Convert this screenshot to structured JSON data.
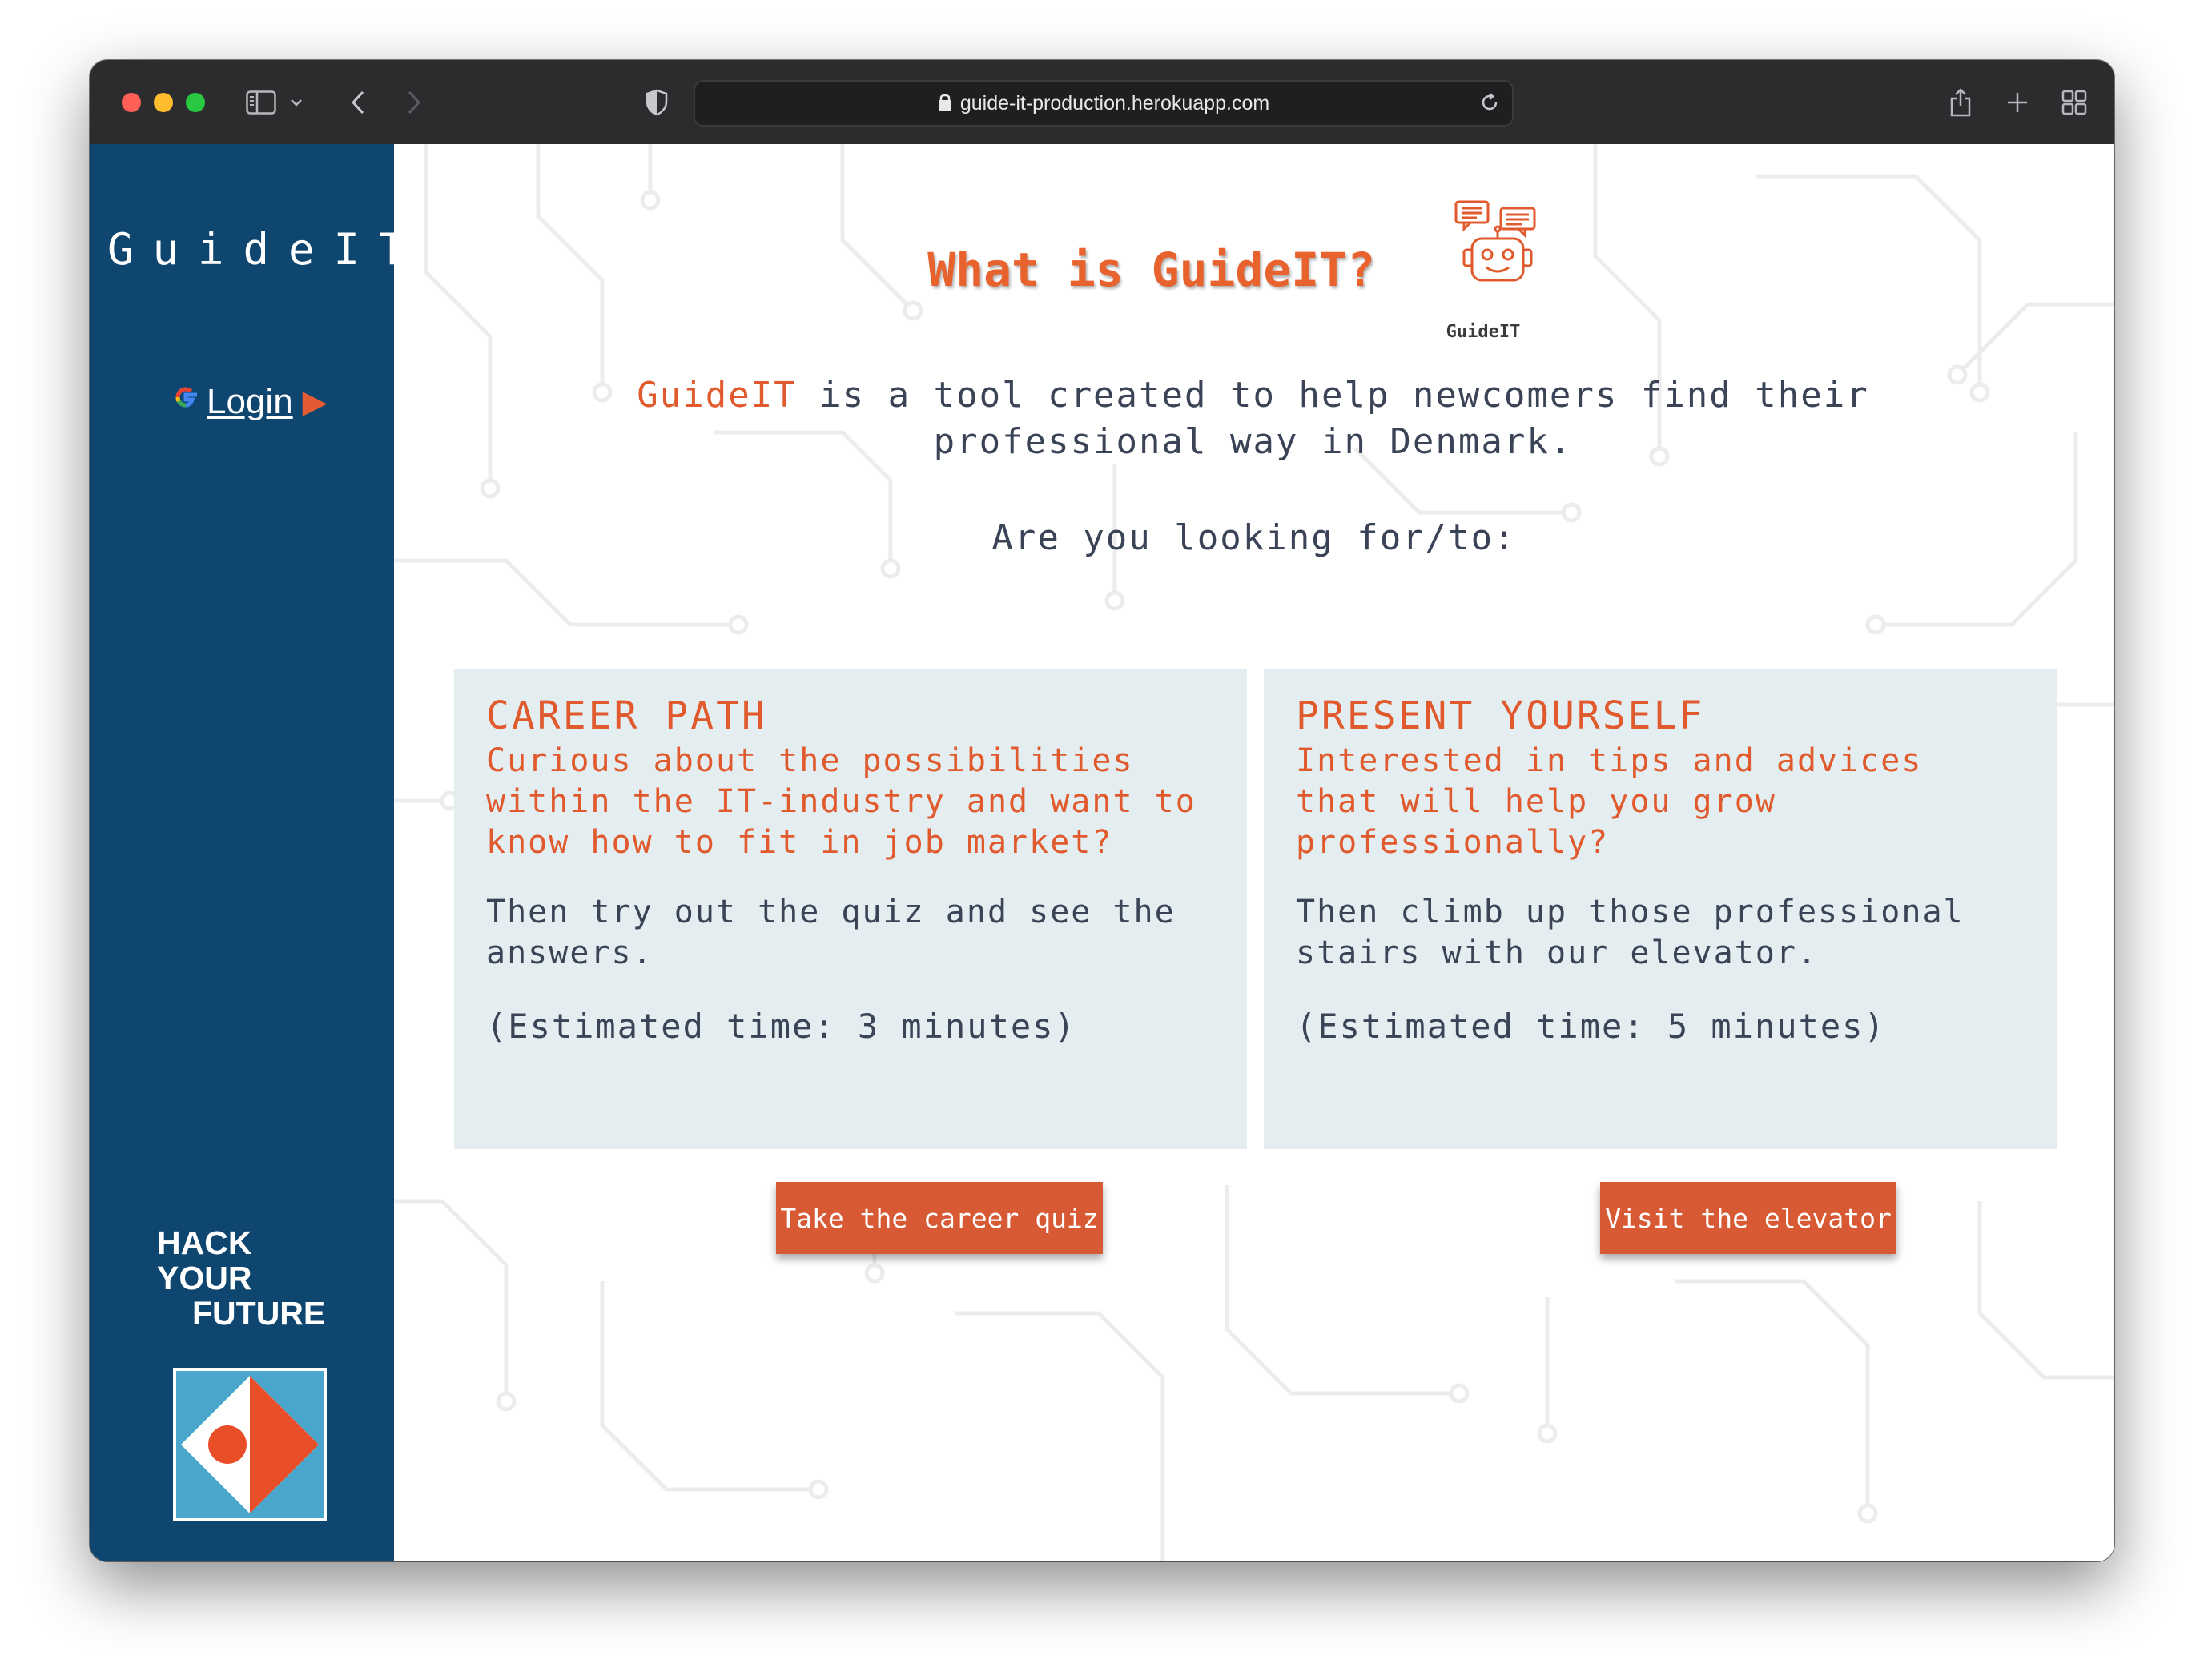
{
  "browser": {
    "url": "guide-it-production.herokuapp.com"
  },
  "sidebar": {
    "brand": "GuideIT",
    "login_label": "Login",
    "login_arrow": "▶",
    "partner_line1": "HACK",
    "partner_line2": "YOUR",
    "partner_line3": "FUTURE"
  },
  "main": {
    "title": "What is GuideIT?",
    "bot_caption": "GuideIT",
    "intro_highlight": "GuideIT",
    "intro_rest": " is a tool created to help newcomers find their professional way in Denmark.",
    "question": "Are you looking for/to:",
    "cards": [
      {
        "title": "CAREER PATH",
        "subtitle": "Curious about the possibilities within the IT-industry and want to know how to fit in job market?",
        "body": "Then try out the quiz and see the answers.",
        "time": "(Estimated time: 3 minutes)",
        "button": "Take the career quiz"
      },
      {
        "title": "PRESENT YOURSELF",
        "subtitle": "Interested in tips and advices that will help you grow professionally?",
        "body": "Then climb up those professional stairs with our elevator.",
        "time": "(Estimated time: 5 minutes)",
        "button": "Visit the elevator"
      }
    ]
  },
  "colors": {
    "sidebar": "#0f4670",
    "accent": "#e05a2e",
    "button": "#d85a35",
    "card": "#e4eef0",
    "text": "#3b4457"
  },
  "icons": [
    "sidebar-toggle-icon",
    "chevron-down-icon",
    "back-icon",
    "forward-icon",
    "shield-icon",
    "lock-icon",
    "reload-icon",
    "share-icon",
    "new-tab-icon",
    "tab-overview-icon",
    "google-icon",
    "chatbot-icon",
    "hack-your-future-logo"
  ]
}
